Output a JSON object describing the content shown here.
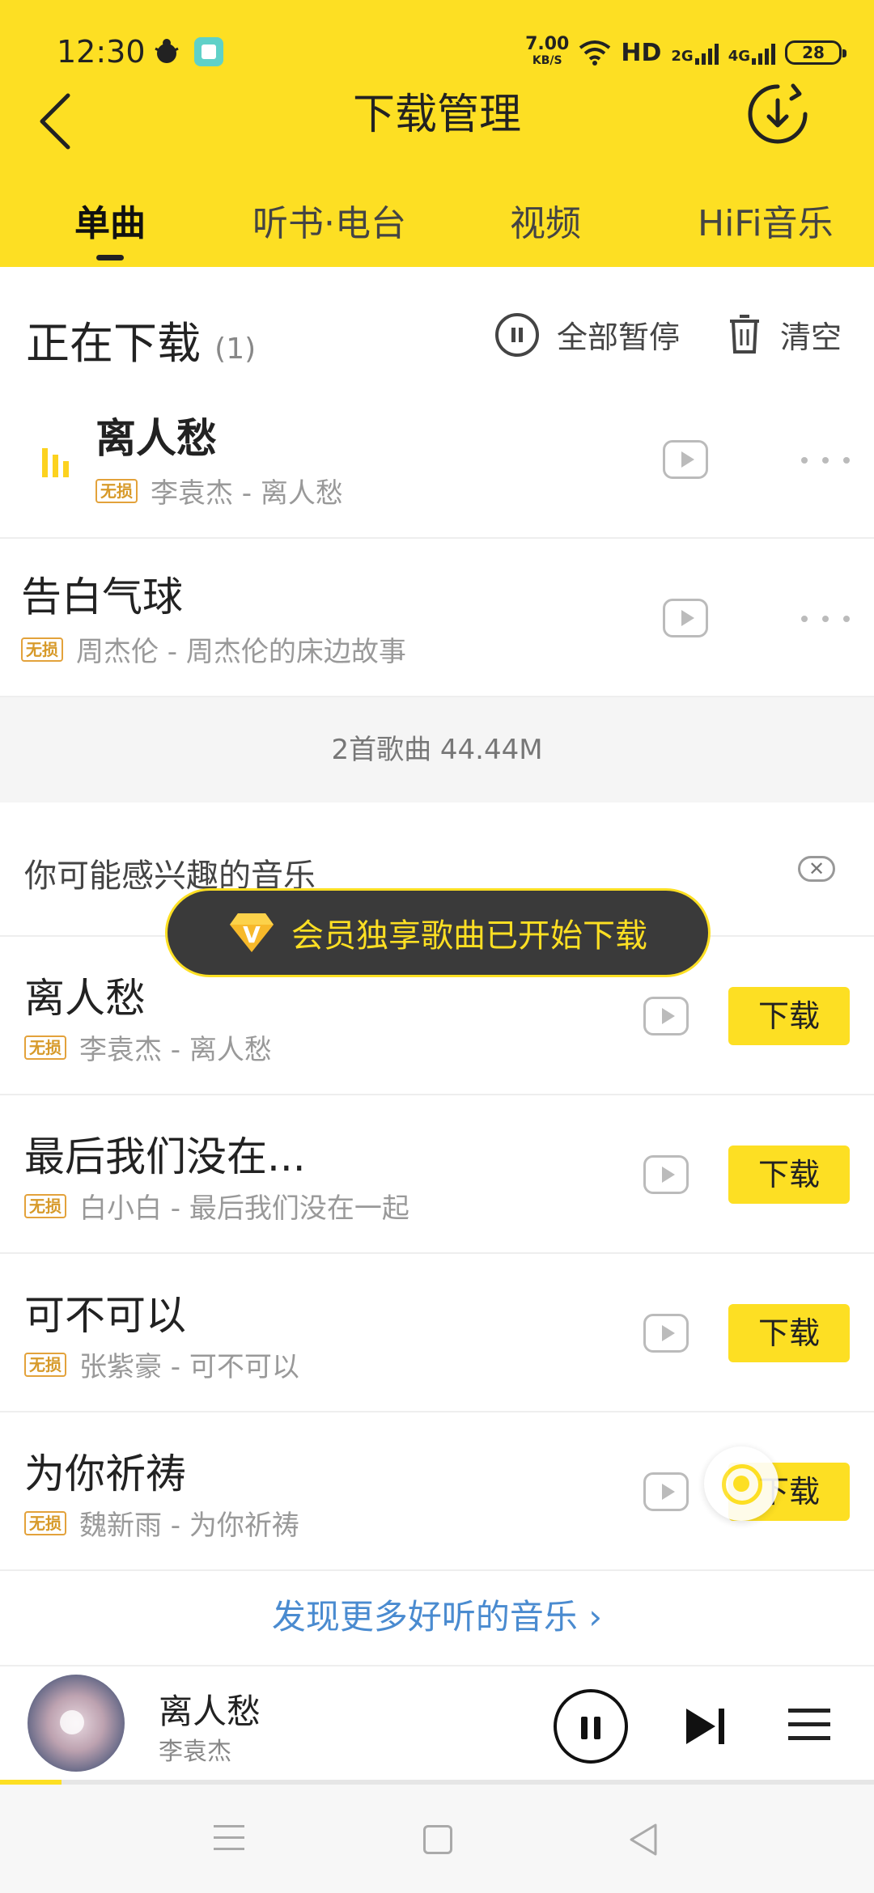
{
  "status_bar": {
    "time": "12:30",
    "net_speed": "7.00",
    "net_unit": "KB/S",
    "hd": "HD",
    "sig1": "2G",
    "sig2": "4G",
    "battery": "28"
  },
  "header": {
    "title": "下载管理",
    "tabs": [
      "单曲",
      "听书·电台",
      "视频",
      "HiFi音乐"
    ]
  },
  "downloading": {
    "title": "正在下载",
    "count": "(1)",
    "pause_all": "全部暂停",
    "clear": "清空",
    "items": [
      {
        "title": "离人愁",
        "badge": "无损",
        "subtitle": "李袁杰 - 离人愁"
      },
      {
        "title": "告白气球",
        "badge": "无损",
        "subtitle": "周杰伦 - 周杰伦的床边故事"
      }
    ],
    "summary": "2首歌曲 44.44M"
  },
  "recommend": {
    "title": "你可能感兴趣的音乐",
    "close_icon": "close-icon",
    "items": [
      {
        "title": "离人愁",
        "badge": "无损",
        "subtitle": "李袁杰 - 离人愁",
        "button": "下载"
      },
      {
        "title": "最后我们没在...",
        "badge": "无损",
        "subtitle": "白小白 - 最后我们没在一起",
        "button": "下载"
      },
      {
        "title": "可不可以",
        "badge": "无损",
        "subtitle": "张紫豪 - 可不可以",
        "button": "下载"
      },
      {
        "title": "为你祈祷",
        "badge": "无损",
        "subtitle": "魏新雨 - 为你祈祷",
        "button": "下载"
      }
    ],
    "discover": "发现更多好听的音乐 ›"
  },
  "toast": {
    "text": "会员独享歌曲已开始下载",
    "icon": "vip-diamond-icon",
    "icon_letter": "V"
  },
  "player": {
    "title": "离人愁",
    "artist": "李袁杰",
    "progress": 0.07
  },
  "colors": {
    "accent": "#fddf23",
    "link": "#4a8bd0",
    "badge": "#e3a23b"
  }
}
